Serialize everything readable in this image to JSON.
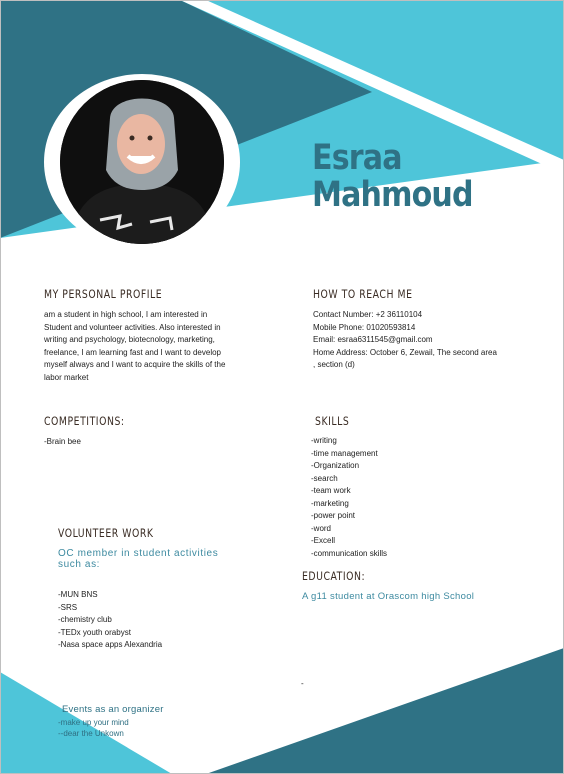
{
  "header": {
    "first_name": "Esraa",
    "last_name": "Mahmoud"
  },
  "profile": {
    "heading": "MY PERSONAL PROFILE",
    "lines": [
      "am a student in high school, I am interested in",
      "Student and volunteer activities. Also interested in",
      "writing and psychology, biotecnology, marketing,",
      "freelance, I am learning fast and I want to develop",
      "myself always and I want to acquire the skills of the",
      "labor market"
    ]
  },
  "contact": {
    "heading": "HOW TO REACH ME",
    "lines": [
      "Contact Number: +2 36110104",
      "Mobile Phone: 01020593814",
      "Email: esraa6311545@gmail.com",
      "Home Address: October 6, Zewail, The second area",
      ", section (d)"
    ]
  },
  "competitions": {
    "heading": "COMPETITIONS:",
    "items": [
      "-Brain bee"
    ]
  },
  "skills": {
    "heading": "SKILLS",
    "items": [
      "-writing",
      "-time management",
      "-Organization",
      "-search",
      "-team work",
      "-marketing",
      "-power point",
      "-word",
      "-Excell",
      "-communication skills"
    ]
  },
  "volunteer": {
    "heading": "VOLUNTEER WORK",
    "subheading_1": "OC member in student activities",
    "subheading_2": "such as:",
    "items": [
      "-MUN BNS",
      "-SRS",
      "-chemistry club",
      "-TEDx youth orabyst",
      "-Nasa space apps Alexandria"
    ]
  },
  "education": {
    "heading": "EDUCATION:",
    "text": "A g11 student at Orascom high  School"
  },
  "events": {
    "heading": "Events as an organizer",
    "items": [
      "-make up your mind",
      "--dear the Unkown"
    ]
  },
  "stray_mark": "-",
  "colors": {
    "dark_teal": "#2f7285",
    "light_cyan": "#4ec5d9",
    "heading_brown": "#3a2c24",
    "accent_text": "#3d8aa0"
  }
}
